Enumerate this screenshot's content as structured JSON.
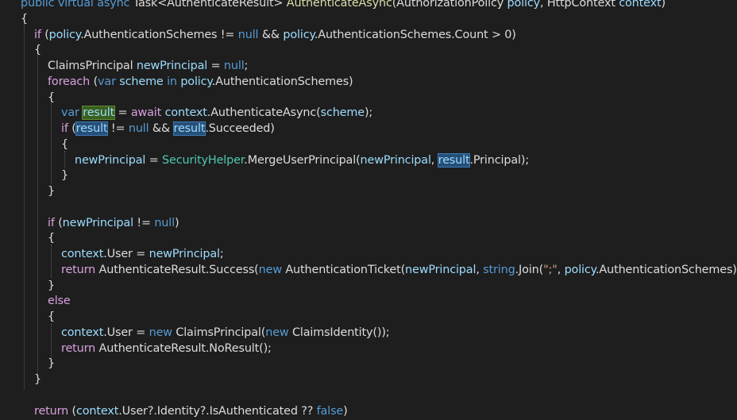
{
  "colors": {
    "background": "#1e1e1e",
    "keyword": "#569cd6",
    "control_keyword": "#d8a0df",
    "type": "#4ec9b0",
    "method": "#dcdcaa",
    "parameter": "#9cdcfe",
    "text": "#dcdcdc",
    "string": "#d69d85",
    "highlight_definition": "#3a5f1f",
    "highlight_reference": "#264f78"
  },
  "code_lines": [
    {
      "tokens": [
        {
          "t": "public virtual async ",
          "c": "kw"
        },
        {
          "t": "Task<AuthenticateResult> ",
          "c": "plain"
        },
        {
          "t": "AuthenticateAsync",
          "c": "method"
        },
        {
          "t": "(AuthorizationPolicy ",
          "c": "plain"
        },
        {
          "t": "policy",
          "c": "param"
        },
        {
          "t": ", HttpContext ",
          "c": "plain"
        },
        {
          "t": "context",
          "c": "param"
        },
        {
          "t": ")",
          "c": "plain"
        }
      ]
    },
    {
      "tokens": [
        {
          "t": "{",
          "c": "plain"
        }
      ]
    },
    {
      "tokens": [
        {
          "t": "if",
          "c": "kw2"
        },
        {
          "t": " (",
          "c": "plain"
        },
        {
          "t": "policy",
          "c": "param"
        },
        {
          "t": ".AuthenticationSchemes != ",
          "c": "plain"
        },
        {
          "t": "null",
          "c": "kw"
        },
        {
          "t": " && ",
          "c": "plain"
        },
        {
          "t": "policy",
          "c": "param"
        },
        {
          "t": ".AuthenticationSchemes.Count > 0)",
          "c": "plain"
        }
      ]
    },
    {
      "tokens": [
        {
          "t": "{",
          "c": "plain"
        }
      ]
    },
    {
      "tokens": [
        {
          "t": "ClaimsPrincipal ",
          "c": "plain"
        },
        {
          "t": "newPrincipal",
          "c": "param"
        },
        {
          "t": " = ",
          "c": "plain"
        },
        {
          "t": "null",
          "c": "kw"
        },
        {
          "t": ";",
          "c": "plain"
        }
      ]
    },
    {
      "tokens": [
        {
          "t": "foreach",
          "c": "kw2"
        },
        {
          "t": " (",
          "c": "plain"
        },
        {
          "t": "var",
          "c": "kw"
        },
        {
          "t": " ",
          "c": "plain"
        },
        {
          "t": "scheme",
          "c": "param"
        },
        {
          "t": " in ",
          "c": "kw"
        },
        {
          "t": "policy",
          "c": "param"
        },
        {
          "t": ".AuthenticationSchemes)",
          "c": "plain"
        }
      ]
    },
    {
      "tokens": [
        {
          "t": "{",
          "c": "plain"
        }
      ]
    },
    {
      "tokens": [
        {
          "t": "var",
          "c": "kw"
        },
        {
          "t": " ",
          "c": "plain"
        },
        {
          "t": "result",
          "c": "param",
          "hl": "def"
        },
        {
          "t": " = ",
          "c": "plain"
        },
        {
          "t": "await",
          "c": "kw2"
        },
        {
          "t": " ",
          "c": "plain"
        },
        {
          "t": "context",
          "c": "param"
        },
        {
          "t": ".AuthenticateAsync(",
          "c": "plain"
        },
        {
          "t": "scheme",
          "c": "param"
        },
        {
          "t": ");",
          "c": "plain"
        }
      ]
    },
    {
      "tokens": [
        {
          "t": "if",
          "c": "kw2"
        },
        {
          "t": " (",
          "c": "plain"
        },
        {
          "t": "result",
          "c": "param",
          "hl": "ref"
        },
        {
          "t": " != ",
          "c": "plain"
        },
        {
          "t": "null",
          "c": "kw"
        },
        {
          "t": " && ",
          "c": "plain"
        },
        {
          "t": "result",
          "c": "param",
          "hl": "ref"
        },
        {
          "t": ".Succeeded)",
          "c": "plain"
        }
      ]
    },
    {
      "tokens": [
        {
          "t": "{",
          "c": "plain"
        }
      ]
    },
    {
      "tokens": [
        {
          "t": "newPrincipal",
          "c": "param"
        },
        {
          "t": " = ",
          "c": "plain"
        },
        {
          "t": "SecurityHelper",
          "c": "type"
        },
        {
          "t": ".MergeUserPrincipal(",
          "c": "plain"
        },
        {
          "t": "newPrincipal",
          "c": "param"
        },
        {
          "t": ", ",
          "c": "plain"
        },
        {
          "t": "result",
          "c": "param",
          "hl": "ref"
        },
        {
          "t": ".Principal);",
          "c": "plain"
        }
      ]
    },
    {
      "tokens": [
        {
          "t": "}",
          "c": "plain"
        }
      ]
    },
    {
      "tokens": [
        {
          "t": "}",
          "c": "plain"
        }
      ]
    },
    {
      "tokens": []
    },
    {
      "tokens": [
        {
          "t": "if",
          "c": "kw2"
        },
        {
          "t": " (",
          "c": "plain"
        },
        {
          "t": "newPrincipal",
          "c": "param"
        },
        {
          "t": " != ",
          "c": "plain"
        },
        {
          "t": "null",
          "c": "kw"
        },
        {
          "t": ")",
          "c": "plain"
        }
      ]
    },
    {
      "tokens": [
        {
          "t": "{",
          "c": "plain"
        }
      ]
    },
    {
      "tokens": [
        {
          "t": "context",
          "c": "param"
        },
        {
          "t": ".User = ",
          "c": "plain"
        },
        {
          "t": "newPrincipal",
          "c": "param"
        },
        {
          "t": ";",
          "c": "plain"
        }
      ]
    },
    {
      "tokens": [
        {
          "t": "return",
          "c": "kw2"
        },
        {
          "t": " AuthenticateResult.Success(",
          "c": "plain"
        },
        {
          "t": "new",
          "c": "kw"
        },
        {
          "t": " AuthenticationTicket(",
          "c": "plain"
        },
        {
          "t": "newPrincipal",
          "c": "param"
        },
        {
          "t": ", ",
          "c": "plain"
        },
        {
          "t": "string",
          "c": "kw"
        },
        {
          "t": ".Join(",
          "c": "plain"
        },
        {
          "t": "\";\"",
          "c": "str"
        },
        {
          "t": ", ",
          "c": "plain"
        },
        {
          "t": "policy",
          "c": "param"
        },
        {
          "t": ".AuthenticationSchemes)));",
          "c": "plain"
        }
      ]
    },
    {
      "tokens": [
        {
          "t": "}",
          "c": "plain"
        }
      ]
    },
    {
      "tokens": [
        {
          "t": "else",
          "c": "kw2"
        }
      ]
    },
    {
      "tokens": [
        {
          "t": "{",
          "c": "plain"
        }
      ]
    },
    {
      "tokens": [
        {
          "t": "context",
          "c": "param"
        },
        {
          "t": ".User = ",
          "c": "plain"
        },
        {
          "t": "new",
          "c": "kw"
        },
        {
          "t": " ClaimsPrincipal(",
          "c": "plain"
        },
        {
          "t": "new",
          "c": "kw"
        },
        {
          "t": " ClaimsIdentity());",
          "c": "plain"
        }
      ]
    },
    {
      "tokens": [
        {
          "t": "return",
          "c": "kw2"
        },
        {
          "t": " AuthenticateResult.NoResult();",
          "c": "plain"
        }
      ]
    },
    {
      "tokens": [
        {
          "t": "}",
          "c": "plain"
        }
      ]
    },
    {
      "tokens": [
        {
          "t": "}",
          "c": "plain"
        }
      ]
    },
    {
      "tokens": []
    },
    {
      "tokens": [
        {
          "t": "return",
          "c": "kw2"
        },
        {
          "t": " (",
          "c": "plain"
        },
        {
          "t": "context",
          "c": "param"
        },
        {
          "t": ".User?.Identity?.IsAuthenticated ?? ",
          "c": "plain"
        },
        {
          "t": "false",
          "c": "kw"
        },
        {
          "t": ")",
          "c": "plain"
        }
      ]
    }
  ]
}
